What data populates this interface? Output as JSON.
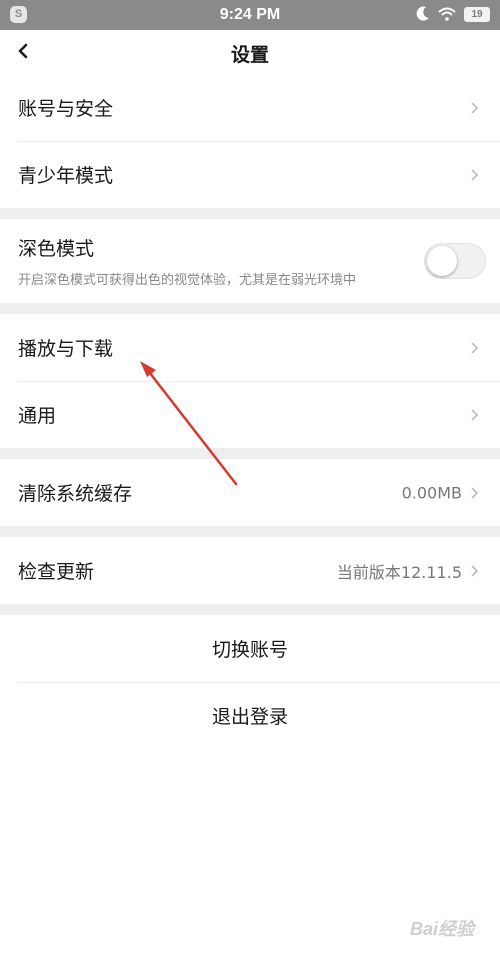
{
  "status_bar": {
    "app_badge": "S",
    "time": "9:24 PM",
    "battery": "19",
    "icons": [
      "moon-icon",
      "wifi-icon",
      "battery-icon"
    ]
  },
  "header": {
    "back_icon": "chevron-left-icon",
    "title": "设置"
  },
  "sections": {
    "account": {
      "security": "账号与安全",
      "youth_mode": "青少年模式"
    },
    "dark_mode": {
      "label": "深色模式",
      "description": "开启深色模式可获得出色的视觉体验，尤其是在弱光环境中",
      "enabled": false
    },
    "general": {
      "playback": "播放与下载",
      "common": "通用"
    },
    "cache": {
      "label": "清除系统缓存",
      "value": "0.00MB"
    },
    "update": {
      "label": "检查更新",
      "value": "当前版本12.11.5"
    },
    "session": {
      "switch_account": "切换账号",
      "logout": "退出登录"
    }
  },
  "watermark": "Bai经验",
  "colors": {
    "status_bar": "#8a8a8a",
    "separator": "#eeeeee",
    "arrow": "#d6392e"
  }
}
